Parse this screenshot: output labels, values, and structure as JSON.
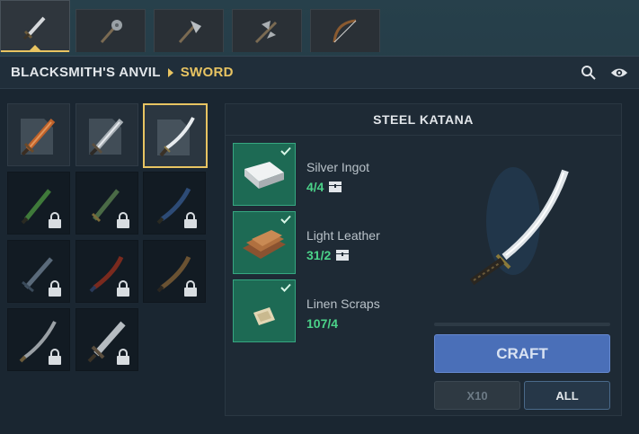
{
  "tabs": [
    {
      "icon": "sword-icon",
      "active": true
    },
    {
      "icon": "mace-icon",
      "active": false
    },
    {
      "icon": "axe-icon",
      "active": false
    },
    {
      "icon": "double-axe-icon",
      "active": false
    },
    {
      "icon": "bow-icon",
      "active": false
    }
  ],
  "header": {
    "station": "BLACKSMITH'S ANVIL",
    "category": "SWORD",
    "icons": [
      "search-icon",
      "eye-icon"
    ]
  },
  "recipes": [
    {
      "weapon": "copper-sword-icon",
      "locked": false,
      "selected": false
    },
    {
      "weapon": "iron-sword-icon",
      "locked": false,
      "selected": false
    },
    {
      "weapon": "steel-katana-icon",
      "locked": false,
      "selected": true
    },
    {
      "weapon": "green-sword-icon",
      "locked": true
    },
    {
      "weapon": "jade-sword-icon",
      "locked": true
    },
    {
      "weapon": "blue-sword-icon",
      "locked": true
    },
    {
      "weapon": "dark-sword-icon",
      "locked": true
    },
    {
      "weapon": "red-sword-icon",
      "locked": true
    },
    {
      "weapon": "bronze-sword-icon",
      "locked": true
    },
    {
      "weapon": "long-katana-icon",
      "locked": true
    },
    {
      "weapon": "serrated-sword-icon",
      "locked": true
    }
  ],
  "detail": {
    "title": "STEEL KATANA",
    "ingredients": [
      {
        "name": "Silver Ingot",
        "qty": "4/4",
        "icon": "silver-ingot-icon",
        "has_chest": true
      },
      {
        "name": "Light Leather",
        "qty": "31/2",
        "icon": "leather-icon",
        "has_chest": true
      },
      {
        "name": "Linen Scraps",
        "qty": "107/4",
        "icon": "linen-icon",
        "has_chest": false
      }
    ],
    "craft_label": "CRAFT",
    "x10_label": "X10",
    "all_label": "ALL"
  },
  "colors": {
    "accent_gold": "#e8c462",
    "ingredient_green": "#1d6a54",
    "qty_green": "#4bd389",
    "craft_blue": "#4a6fb8"
  }
}
